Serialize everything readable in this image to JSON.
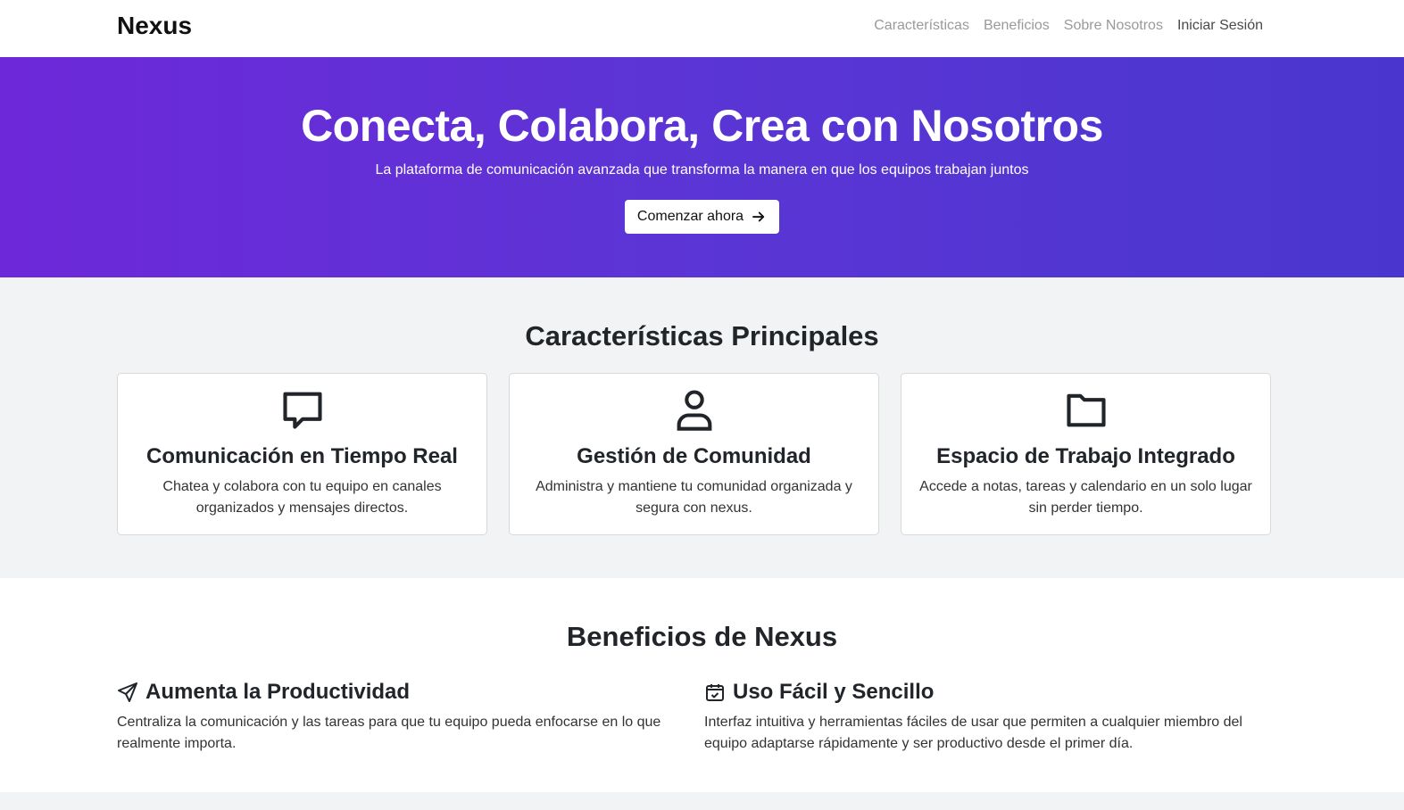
{
  "nav": {
    "brand": "Nexus",
    "links": [
      {
        "label": "Características"
      },
      {
        "label": "Beneficios"
      },
      {
        "label": "Sobre Nosotros"
      },
      {
        "label": "Iniciar Sesión"
      }
    ]
  },
  "hero": {
    "title": "Conecta, Colabora, Crea con Nosotros",
    "subtitle": "La plataforma de comunicación avanzada que transforma la manera en que los equipos trabajan juntos",
    "cta_label": "Comenzar ahora",
    "cta_icon": "arrow-right-icon",
    "gradient_start": "#6d28d9",
    "gradient_end": "#4a36cf"
  },
  "features": {
    "heading": "Características Principales",
    "items": [
      {
        "icon": "chat-bubble-icon",
        "title": "Comunicación en Tiempo Real",
        "text": "Chatea y colabora con tu equipo en canales organizados y mensajes directos."
      },
      {
        "icon": "user-icon",
        "title": "Gestión de Comunidad",
        "text": "Administra y mantiene tu comunidad organizada y segura con nexus."
      },
      {
        "icon": "folder-icon",
        "title": "Espacio de Trabajo Integrado",
        "text": "Accede a notas, tareas y calendario en un solo lugar sin perder tiempo."
      }
    ]
  },
  "benefits": {
    "heading": "Beneficios de Nexus",
    "items": [
      {
        "icon": "send-icon",
        "title": "Aumenta la Productividad",
        "text": "Centraliza la comunicación y las tareas para que tu equipo pueda enfocarse en lo que realmente importa."
      },
      {
        "icon": "calendar-check-icon",
        "title": "Uso Fácil y Sencillo",
        "text": "Interfaz intuitiva y herramientas fáciles de usar que permiten a cualquier miembro del equipo adaptarse rápidamente y ser productivo desde el primer día."
      }
    ]
  }
}
